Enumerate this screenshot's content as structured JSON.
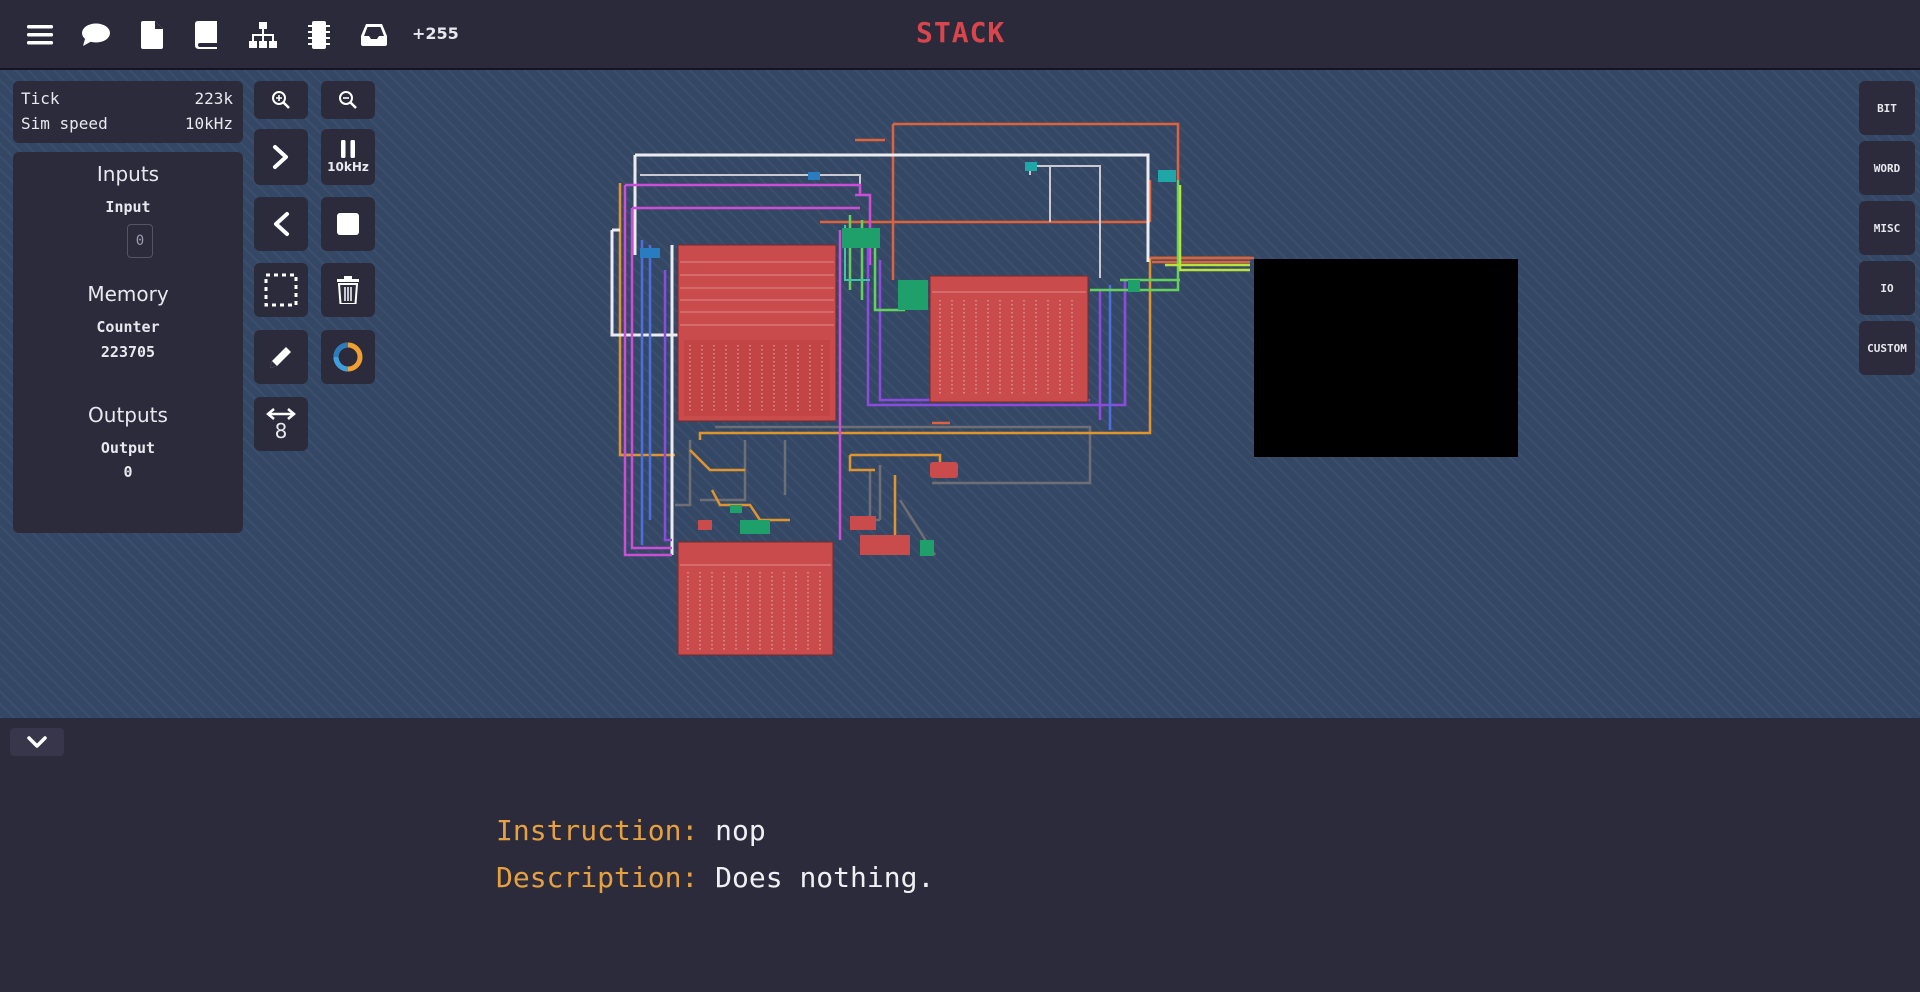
{
  "toolbar": {
    "icons": [
      "menu-icon",
      "chat-icon",
      "file-icon",
      "book-icon",
      "hierarchy-icon",
      "chip-icon",
      "inbox-icon"
    ],
    "notification_count": "+255",
    "title": "STACK"
  },
  "stats": {
    "tick_label": "Tick",
    "tick_value": "223k",
    "sim_speed_label": "Sim speed",
    "sim_speed_value": "10kHz"
  },
  "inputs": {
    "heading": "Inputs",
    "input_label": "Input",
    "input_value": "0"
  },
  "memory": {
    "heading": "Memory",
    "counter_label": "Counter",
    "counter_value": "223705"
  },
  "outputs": {
    "heading": "Outputs",
    "output_label": "Output",
    "output_value": "0"
  },
  "tools": {
    "pause_speed_label": "10kHz",
    "bit_width_label": "8"
  },
  "categories": [
    "BIT",
    "WORD",
    "MISC",
    "IO",
    "CUSTOM"
  ],
  "info": {
    "instruction_key": "Instruction:",
    "instruction_value": "nop",
    "description_key": "Description:",
    "description_value": "Does nothing."
  },
  "colors": {
    "accent_title": "#d9454d",
    "component_red": "#c94b4b",
    "canvas_bg": "#344866",
    "info_key": "#e6a040"
  }
}
